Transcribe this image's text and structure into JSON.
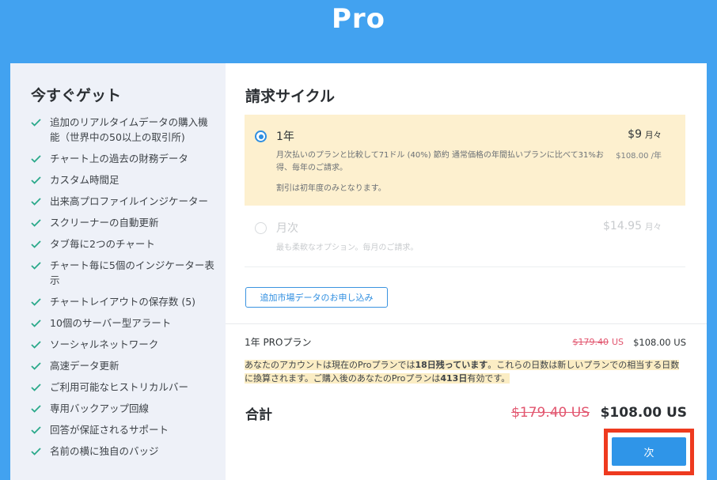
{
  "header": {
    "title": "Pro"
  },
  "sidebar": {
    "title": "今すぐゲット",
    "features": [
      "追加のリアルタイムデータの購入機能（世界中の50以上の取引所)",
      "チャート上の過去の財務データ",
      "カスタム時間足",
      "出来高プロファイルインジケーター",
      "スクリーナーの自動更新",
      "タブ毎に2つのチャート",
      "チャート毎に5個のインジケーター表示",
      "チャートレイアウトの保存数 (5)",
      "10個のサーバー型アラート",
      "ソーシャルネットワーク",
      "高速データ更新",
      "ご利用可能なヒストリカルバー",
      "専用バックアップ回線",
      "回答が保証されるサポート",
      "名前の横に独自のバッジ"
    ],
    "check_color": "#2aa98a"
  },
  "billing": {
    "title": "請求サイクル",
    "yearly": {
      "name": "1年",
      "price": "$9",
      "price_unit": "月々",
      "sub_price": "$108.00 /年",
      "description": "月次払いのプランと比較して71ドル (40%) 節約 通常価格の年間払いプランに比べて31%お得、毎年のご請求。",
      "note": "割引は初年度のみとなります。",
      "selected": true
    },
    "monthly": {
      "name": "月次",
      "price": "$14.95",
      "price_unit": "月々",
      "description": "最も柔軟なオプション。毎月のご請求。",
      "selected": false
    },
    "addon_button": "追加市場データのお申し込み"
  },
  "summary": {
    "plan_label": "1年 PROプラン",
    "old_price": "$179.40",
    "old_price_unit": "US",
    "price": "$108.00 US",
    "notice_part1": "あなたのアカウントは現在のProプランでは",
    "notice_days": "18日残っています",
    "notice_part2": "。これらの日数は新しいプランでの相当する日数に換算されます。ご購入後のあなたのProプランは",
    "notice_new_days": "413日",
    "notice_part3": "有効です。",
    "total_label": "合計",
    "total_old_price": "$179.40 US",
    "total_price": "$108.00 US"
  },
  "actions": {
    "next_label": "次"
  },
  "colors": {
    "background": "#42a2f0",
    "accent": "#2f95e8",
    "strike": "#e2566f",
    "highlight_outline": "#ee3a1f"
  }
}
